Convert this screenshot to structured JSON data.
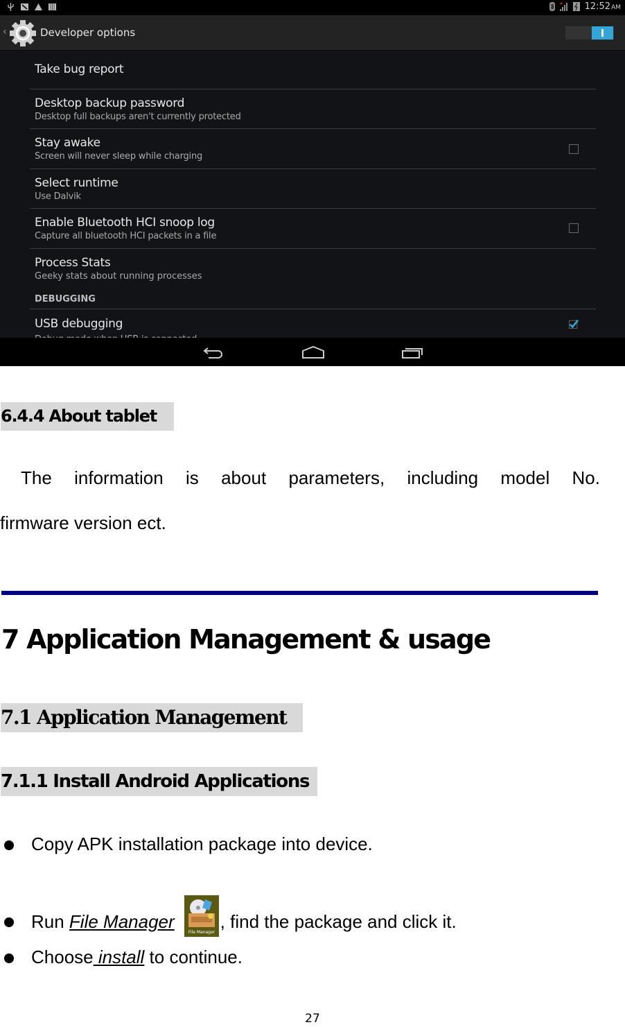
{
  "screenshot": {
    "status_bar": {
      "left_icons": [
        "usb-icon",
        "screenshot-icon",
        "warning-icon",
        "storage-icon"
      ],
      "right_icons": [
        "bluetooth-icon",
        "signal-icon",
        "battery-charging-icon"
      ],
      "time": "12:52",
      "ampm": "AM"
    },
    "action_bar": {
      "title": "Developer options",
      "master_switch": "on",
      "accent_color": "#33a6d8"
    },
    "settings": [
      {
        "title": "Take bug report",
        "summary": ""
      },
      {
        "title": "Desktop backup password",
        "summary": "Desktop full backups aren't currently protected"
      },
      {
        "title": "Stay awake",
        "summary": "Screen will never sleep while charging",
        "checkbox": false
      },
      {
        "title": "Select runtime",
        "summary": "Use Dalvik"
      },
      {
        "title": "Enable Bluetooth HCI snoop log",
        "summary": "Capture all bluetooth HCI packets in a file",
        "checkbox": false
      },
      {
        "title": "Process Stats",
        "summary": "Geeky stats about running processes"
      }
    ],
    "section_header": "DEBUGGING",
    "usb_debugging": {
      "title": "USB debugging",
      "summary": "Debug mode when USB is connected",
      "checkbox": true
    },
    "nav_bar": [
      "back-icon",
      "home-icon",
      "recents-icon"
    ]
  },
  "document": {
    "heading_644": "6.4.4 About tablet",
    "para_line1": "The information is about parameters, including model No.",
    "para_line2": "firmware version ect.",
    "rule_color": "#000080",
    "heading_7": "7 Application Management & usage",
    "heading_71": "7.1 Application Management",
    "heading_711": "7.1.1 Install Android Applications",
    "bullets": [
      {
        "text": "Copy APK installation package into device."
      },
      {
        "pre": "Run ",
        "link": "File Manager",
        "icon_label": "File Manager",
        "post": ", find the package and click it."
      },
      {
        "pre": "Choose",
        "link": " install",
        "post": " to continue."
      }
    ],
    "page_number": "27"
  }
}
